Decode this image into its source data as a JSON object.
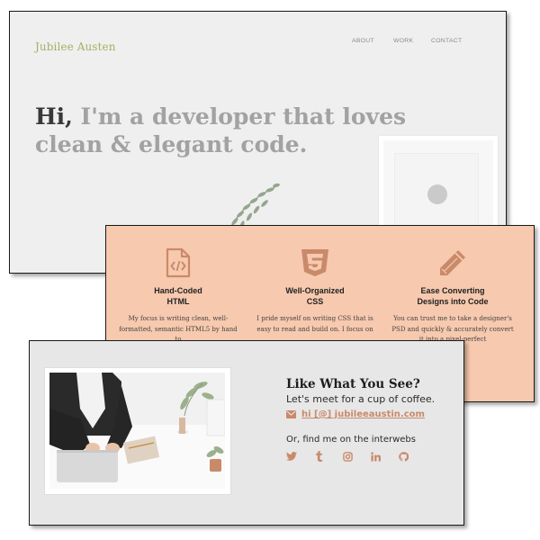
{
  "hero": {
    "logo": "Jubilee Austen",
    "nav": [
      "ABOUT",
      "WORK",
      "CONTACT"
    ],
    "headline_hi": "Hi,",
    "headline_rest": " I'm a developer that loves clean & elegant code."
  },
  "features": [
    {
      "icon": "html-file-icon",
      "title": "Hand-Coded\nHTML",
      "text": "My focus is writing clean, well-formatted, semantic HTML5 by hand to"
    },
    {
      "icon": "css3-icon",
      "title": "Well-Organized\nCSS",
      "text": "I pride myself on writing CSS that is easy to read and build on. I focus on"
    },
    {
      "icon": "pencil-icon",
      "title": "Ease Converting\nDesigns into Code",
      "text": "You can trust me to take a designer's PSD and quickly & accurately convert it into a pixel-perfect"
    }
  ],
  "contact": {
    "title": "Like What You See?",
    "subtitle": "Let's meet for a cup of coffee.",
    "email": "hi [@] jubileeaustin.com",
    "find_text": "Or, find me on the interwebs",
    "socials": [
      "twitter-icon",
      "tumblr-icon",
      "instagram-icon",
      "linkedin-icon",
      "github-icon"
    ]
  },
  "colors": {
    "accent": "#c98a6a",
    "logo": "#a6b062",
    "features_bg": "#f7c9ae",
    "hero_bg": "#efefef",
    "contact_bg": "#e7e7e7"
  }
}
